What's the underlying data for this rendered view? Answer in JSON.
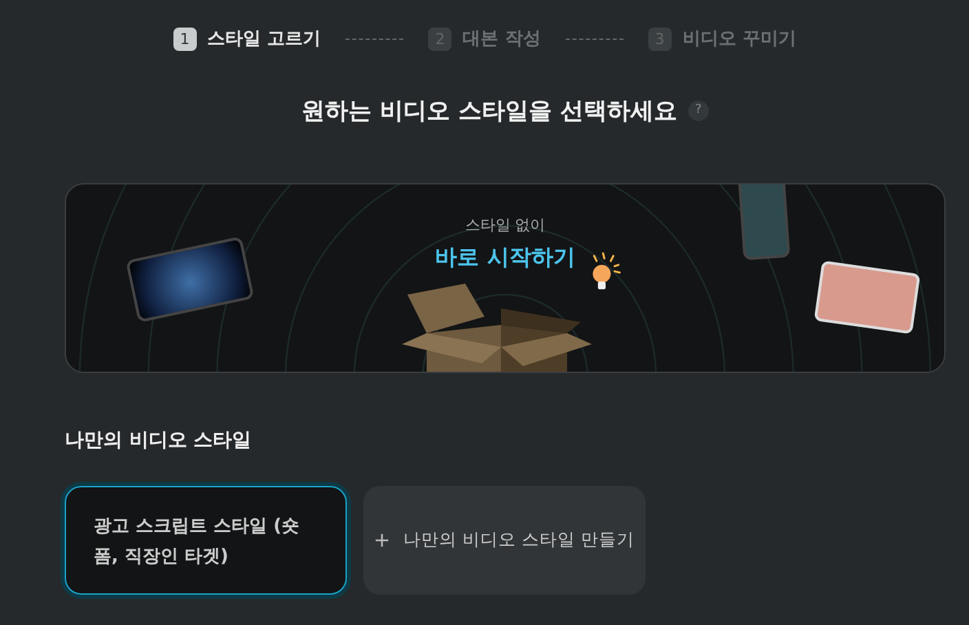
{
  "steps": [
    {
      "number": "1",
      "label": "스타일 고르기",
      "selected": true
    },
    {
      "number": "2",
      "label": "대본 작성",
      "selected": false
    },
    {
      "number": "3",
      "label": "비디오 꾸미기",
      "selected": false
    }
  ],
  "heading": {
    "title": "원하는 비디오 스타일을 선택하세요",
    "help": "?"
  },
  "banner": {
    "subtitle": "스타일 없이",
    "action": "바로 시작하기"
  },
  "my_styles": {
    "title": "나만의 비디오 스타일",
    "cards": [
      {
        "kind": "style",
        "label": "광고 스크립트 스타일 (숏폼, 직장인 타겟)",
        "selected": true
      },
      {
        "kind": "create",
        "label": "나만의 비디오 스타일 만들기",
        "selected": false
      }
    ]
  }
}
